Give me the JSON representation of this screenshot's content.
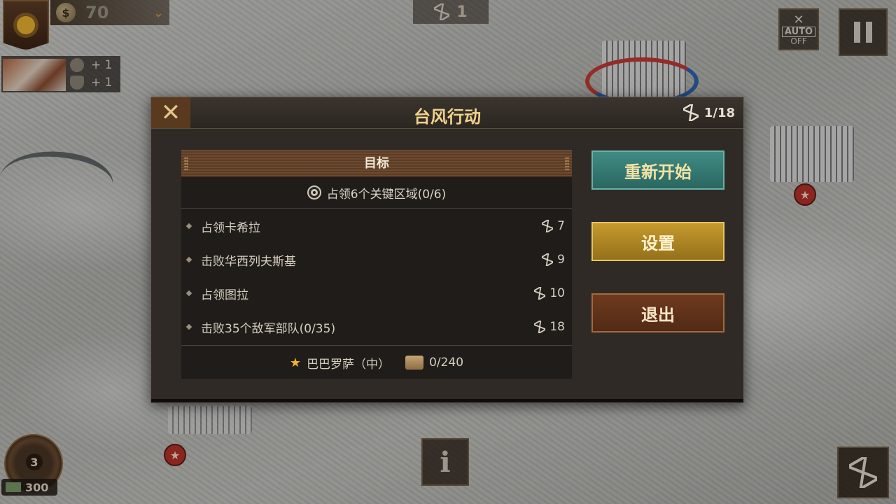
{
  "hud": {
    "money": "70",
    "turn_counter": "1",
    "region_bonus_money": "+ 1",
    "region_bonus_defense": "+ 1",
    "auto_label": "AUTO",
    "auto_state": "OFF",
    "level": "3",
    "cash": "300",
    "info_label": "i"
  },
  "modal": {
    "title": "台风行动",
    "turns": "1/18",
    "objectives_header": "目标",
    "main_objective": "占领6个关键区域(0/6)",
    "sub_objectives": [
      {
        "label": "占领卡希拉",
        "value": "7"
      },
      {
        "label": "击败华西列夫斯基",
        "value": "9"
      },
      {
        "label": "占领图拉",
        "value": "10"
      },
      {
        "label": "击败35个敌军部队(0/35)",
        "value": "18"
      }
    ],
    "difficulty": "巴巴罗萨（中）",
    "reward_progress": "0/240",
    "buttons": {
      "restart": "重新开始",
      "settings": "设置",
      "exit": "退出"
    }
  },
  "colors": {
    "title_gold": "#f0d28e",
    "restart_teal": "#2b6761",
    "settings_gold": "#c59a2d",
    "exit_brown": "#6e3a1f"
  }
}
